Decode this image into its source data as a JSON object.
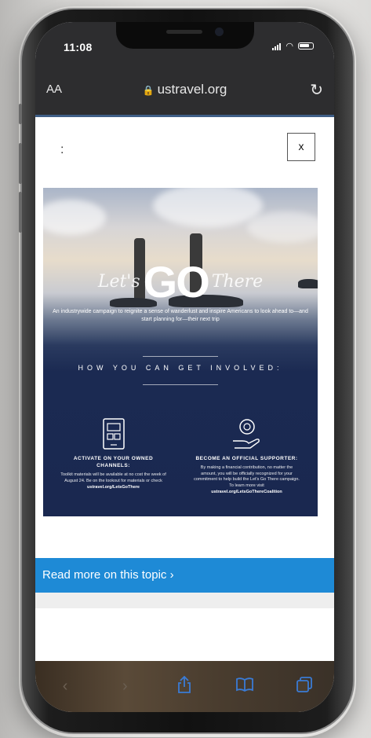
{
  "status_bar": {
    "time": "11:08"
  },
  "browser": {
    "text_size_label": "AA",
    "url": "ustravel.org",
    "lock_icon": "lock-icon",
    "reload_icon": "reload-icon"
  },
  "modal": {
    "title_text": ":",
    "close_label": "x"
  },
  "promo": {
    "logo_pre": "Let's",
    "logo_main": "GO",
    "logo_post": "There",
    "tagline": "An industrywide campaign to reignite a sense of wanderlust and inspire Americans to look ahead to—and start planning for—their next trip",
    "heading": "HOW YOU CAN GET INVOLVED:",
    "left": {
      "icon": "phone-channels-icon",
      "title": "ACTIVATE ON YOUR OWNED CHANNELS:",
      "body": "Toolkit materials will be available at no cost the week of August 24. Be on the lookout for materials or check",
      "link": "ustravel.org/LetsGoThere"
    },
    "right": {
      "icon": "hand-coin-icon",
      "title": "BECOME AN OFFICIAL SUPPORTER:",
      "body": "By making a financial contribution, no matter the amount, you will be officially recognized for your commitment to help build the Let's Go There campaign. To learn more visit",
      "link": "ustravel.org/LetsGoThereCoalition"
    }
  },
  "read_more": {
    "label": "Read more on this topic ›"
  },
  "toolbar": {
    "back_icon": "chevron-left-icon",
    "forward_icon": "chevron-right-icon",
    "share_icon": "share-icon",
    "bookmarks_icon": "book-icon",
    "tabs_icon": "tabs-icon"
  },
  "colors": {
    "accent": "#1e8ad6",
    "promo_navy": "#1b2a52",
    "browser_chrome": "#2d2d2f"
  }
}
